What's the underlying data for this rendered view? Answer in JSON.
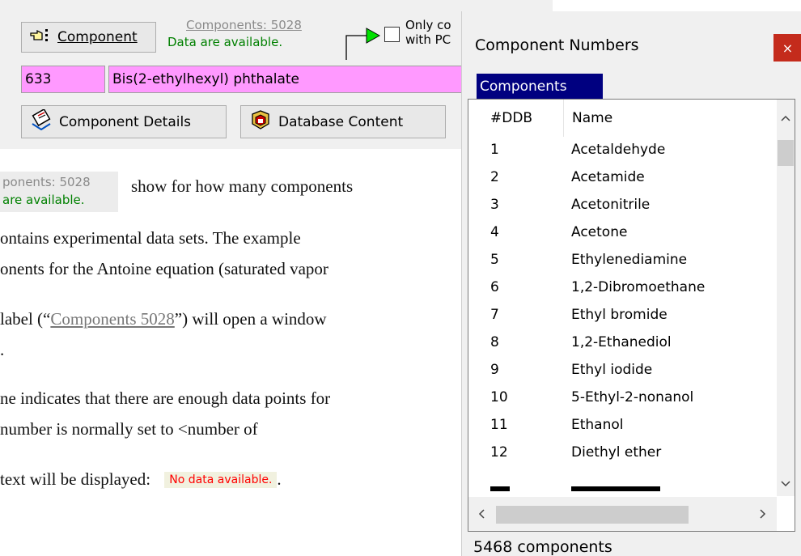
{
  "panel": {
    "component_button": "Component",
    "components_link": "Components: 5028",
    "data_available": "Data are available.",
    "only_line1": "Only co",
    "only_line2": "with PC",
    "ddb_number": "633",
    "component_name": "Bis(2-ethylhexyl) phthalate",
    "details_button": "Component Details",
    "database_button": "Database Content"
  },
  "doc": {
    "snip_line1": "ponents: 5028",
    "snip_line2": "are available.",
    "l1": "show for how many components",
    "l2": "ontains experimental data sets. The example",
    "l3": "onents for the Antoine equation (saturated vapor",
    "l4a": "label (“",
    "l4link": "Components 5028",
    "l4b": "”) will open a window",
    "l5": ".",
    "l6": "ne indicates that there are enough data points for",
    "l7": "number is normally set to <number of",
    "l8": "text will be displayed:",
    "no_data": "No data available.",
    "l8end": "."
  },
  "window": {
    "title": "Component Numbers",
    "close": "×",
    "tab": "Components",
    "headers": {
      "num": "#DDB",
      "name": "Name"
    },
    "rows": [
      {
        "num": "1",
        "name": "Acetaldehyde"
      },
      {
        "num": "2",
        "name": "Acetamide"
      },
      {
        "num": "3",
        "name": "Acetonitrile"
      },
      {
        "num": "4",
        "name": "Acetone"
      },
      {
        "num": "5",
        "name": "Ethylenediamine"
      },
      {
        "num": "6",
        "name": "1,2-Dibromoethane"
      },
      {
        "num": "7",
        "name": "Ethyl bromide"
      },
      {
        "num": "8",
        "name": "1,2-Ethanediol"
      },
      {
        "num": "9",
        "name": "Ethyl iodide"
      },
      {
        "num": "10",
        "name": "5-Ethyl-2-nonanol"
      },
      {
        "num": "11",
        "name": "Ethanol"
      },
      {
        "num": "12",
        "name": "Diethyl ether"
      }
    ],
    "status": "5468 components"
  }
}
